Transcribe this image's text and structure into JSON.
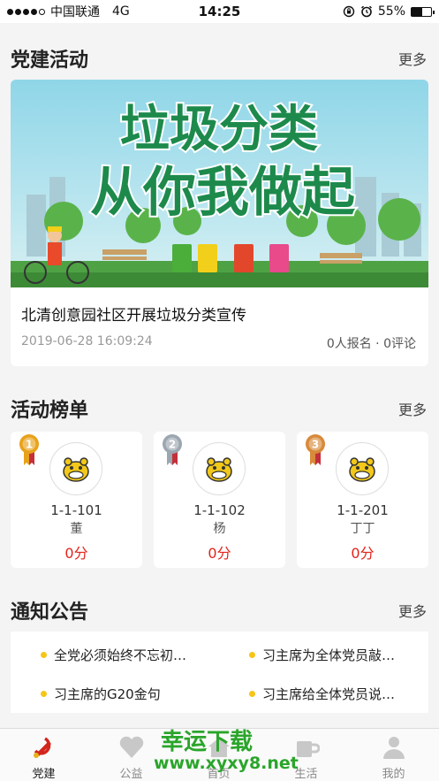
{
  "status": {
    "carrier": "中国联通",
    "network": "4G",
    "time": "14:25",
    "battery": "55%",
    "battery_level": 0.55
  },
  "sections": {
    "activity": {
      "title": "党建活动",
      "more": "更多"
    },
    "ranking": {
      "title": "活动榜单",
      "more": "更多"
    },
    "notice": {
      "title": "通知公告",
      "more": "更多"
    }
  },
  "activity": {
    "banner_line1": "垃圾分类",
    "banner_line2": "从你我做起",
    "title": "北清创意园社区开展垃圾分类宣传",
    "date": "2019-06-28 16:09:24",
    "stats": "0人报名 · 0评论"
  },
  "ranking": [
    {
      "medal": "1",
      "room": "1-1-101",
      "name": "董",
      "score": "0分",
      "medal_color": "#e8a21a"
    },
    {
      "medal": "2",
      "room": "1-1-102",
      "name": "杨",
      "score": "0分",
      "medal_color": "#9ba6b0"
    },
    {
      "medal": "3",
      "room": "1-1-201",
      "name": "丁丁",
      "score": "0分",
      "medal_color": "#d88a3a"
    }
  ],
  "notices": [
    "全党必须始终不忘初…",
    "习主席为全体党员敲…",
    "习主席的G20金句",
    "习主席给全体党员说…"
  ],
  "tabs": [
    {
      "label": "党建",
      "icon": "party-emblem-icon",
      "active": true
    },
    {
      "label": "公益",
      "icon": "heart-icon",
      "active": false
    },
    {
      "label": "首页",
      "icon": "home-icon",
      "active": false
    },
    {
      "label": "生活",
      "icon": "cup-icon",
      "active": false
    },
    {
      "label": "我的",
      "icon": "person-icon",
      "active": false
    }
  ],
  "watermark": {
    "text": "幸运下载",
    "url": "www.xyxy8.net"
  },
  "colors": {
    "accent_red": "#e2231a",
    "bullet": "#f5c518",
    "banner_green": "#1d8a4c"
  }
}
